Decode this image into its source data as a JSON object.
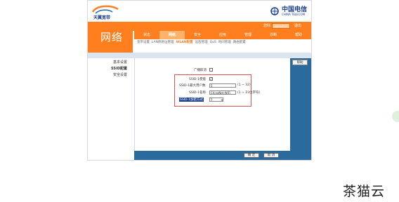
{
  "header": {
    "tel_logo_text": "天翼宽带",
    "cn_logo_zh": "中国电信",
    "cn_logo_en": "CHINA TELECOM",
    "user_label": "您好:",
    "user_value": "useradmin",
    "logout": "退出"
  },
  "section_title": "网络",
  "tabs": [
    "状态",
    "网络",
    "安全",
    "应用",
    "管理",
    "诊断",
    "帮助"
  ],
  "active_tab_index": 1,
  "subtabs": [
    "宽带设置",
    "LAN侧地址管理",
    "WLAN配置",
    "远程管理",
    "QoS",
    "时间管理",
    "路由配置"
  ],
  "active_subtab_index": 2,
  "sidebar": {
    "items": [
      "基本设置",
      "SSID配置",
      "安全设置"
    ]
  },
  "form": {
    "broadcast_label": "广播取消",
    "ssid_enable_label": "SSID-1使能",
    "max_users_label": "SSID-1最大用户数",
    "max_users_value": "5",
    "max_users_hint": "(1 ~ 32)",
    "ssid_name_label": "SSID-1名称",
    "ssid_name_value": "ChinaNet-WiFi",
    "ssid_name_hint": "(1 ~ 23位字符)",
    "encrypt_label": "SSID-1加密方式",
    "encrypt_value": "7"
  },
  "buttons": {
    "help": "帮助",
    "confirm": "确 定",
    "cancel": "取 消"
  },
  "watermark": "茶猫云",
  "colors": {
    "orange": "#ff7f1f",
    "blue": "#2a6a9c",
    "highlight_border": "#e05050"
  }
}
